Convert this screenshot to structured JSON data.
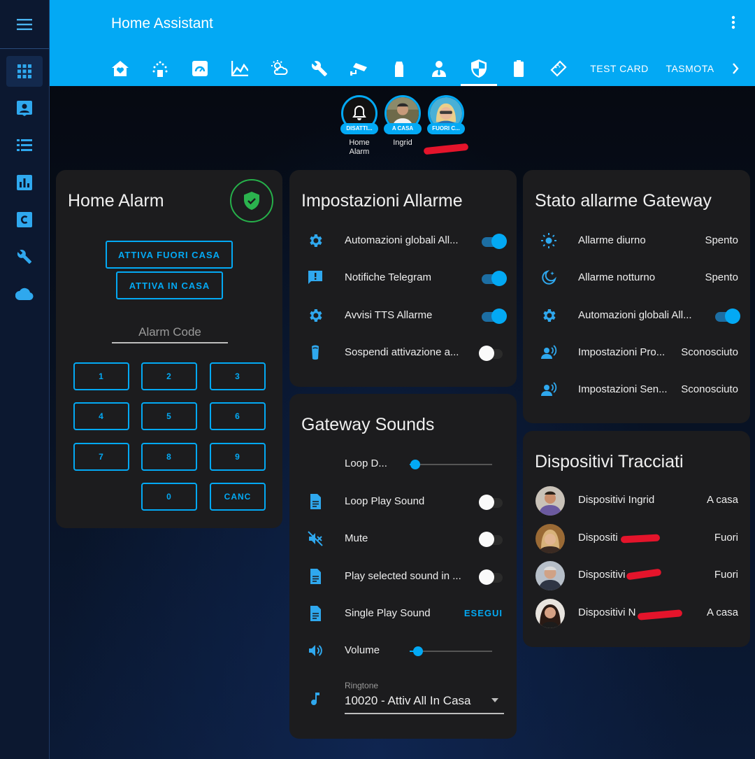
{
  "app": {
    "title": "Home Assistant"
  },
  "tabs": {
    "icons": [
      "home-heart-icon",
      "sprinkler-icon",
      "gauge-icon",
      "chart-line-icon",
      "weather-icon",
      "wrench-icon",
      "cctv-icon",
      "spray-icon",
      "account-tie-icon",
      "shield-icon",
      "battery-icon",
      "ruler-icon"
    ],
    "test_card": "TEST CARD",
    "tasmota": "TASMOTA"
  },
  "badges": [
    {
      "state": "DISATTI...",
      "name": "Home Alarm"
    },
    {
      "state": "A CASA",
      "name": "Ingrid"
    },
    {
      "state": "FUORI C...",
      "name": ""
    }
  ],
  "alarm_card": {
    "title": "Home Alarm",
    "btn_away": "ATTIVA FUORI CASA",
    "btn_home": "ATTIVA IN CASA",
    "code_placeholder": "Alarm Code",
    "keys": [
      "1",
      "2",
      "3",
      "4",
      "5",
      "6",
      "7",
      "8",
      "9",
      "0",
      "CANC"
    ]
  },
  "settings_card": {
    "title": "Impostazioni Allarme",
    "rows": [
      {
        "label": "Automazioni globali All...",
        "on": true,
        "icon": "gear-icon"
      },
      {
        "label": "Notifiche Telegram",
        "on": true,
        "icon": "message-alert-icon"
      },
      {
        "label": "Avvisi TTS Allarme",
        "on": true,
        "icon": "gear-icon"
      },
      {
        "label": "Sospendi attivazione a...",
        "on": false,
        "icon": "cup-icon"
      }
    ]
  },
  "sounds_card": {
    "title": "Gateway Sounds",
    "loop_label": "Loop D...",
    "loop_level": 0.07,
    "loop_play_label": "Loop Play Sound",
    "loop_play_on": false,
    "mute_label": "Mute",
    "mute_on": false,
    "play_selected_label": "Play selected sound in ...",
    "play_selected_on": false,
    "single_play_label": "Single Play Sound",
    "single_play_action": "ESEGUI",
    "volume_label": "Volume",
    "volume_level": 0.1,
    "ringtone_label": "Ringtone",
    "ringtone_value": "10020 - Attiv All In Casa"
  },
  "gateway_card": {
    "title": "Stato allarme Gateway",
    "rows": [
      {
        "label": "Allarme diurno",
        "value": "Spento",
        "icon": "sun-icon"
      },
      {
        "label": "Allarme notturno",
        "value": "Spento",
        "icon": "moon-icon"
      },
      {
        "label": "Automazioni globali All...",
        "toggle_on": true,
        "icon": "gear-icon"
      },
      {
        "label": "Impostazioni Pro...",
        "value": "Sconosciuto",
        "icon": "account-voice-icon"
      },
      {
        "label": "Impostazioni Sen...",
        "value": "Sconosciuto",
        "icon": "account-voice-icon"
      }
    ]
  },
  "tracked_card": {
    "title": "Dispositivi Tracciati",
    "rows": [
      {
        "label": "Dispositivi Ingrid",
        "value": "A casa"
      },
      {
        "label": "Dispositi",
        "value": "Fuori"
      },
      {
        "label": "Dispositivi",
        "value": "Fuori"
      },
      {
        "label": "Dispositivi N",
        "value": "A casa"
      }
    ]
  },
  "colors": {
    "accent": "#03a9f4",
    "card": "#1c1c1e",
    "sidebar": "#0c1830"
  }
}
